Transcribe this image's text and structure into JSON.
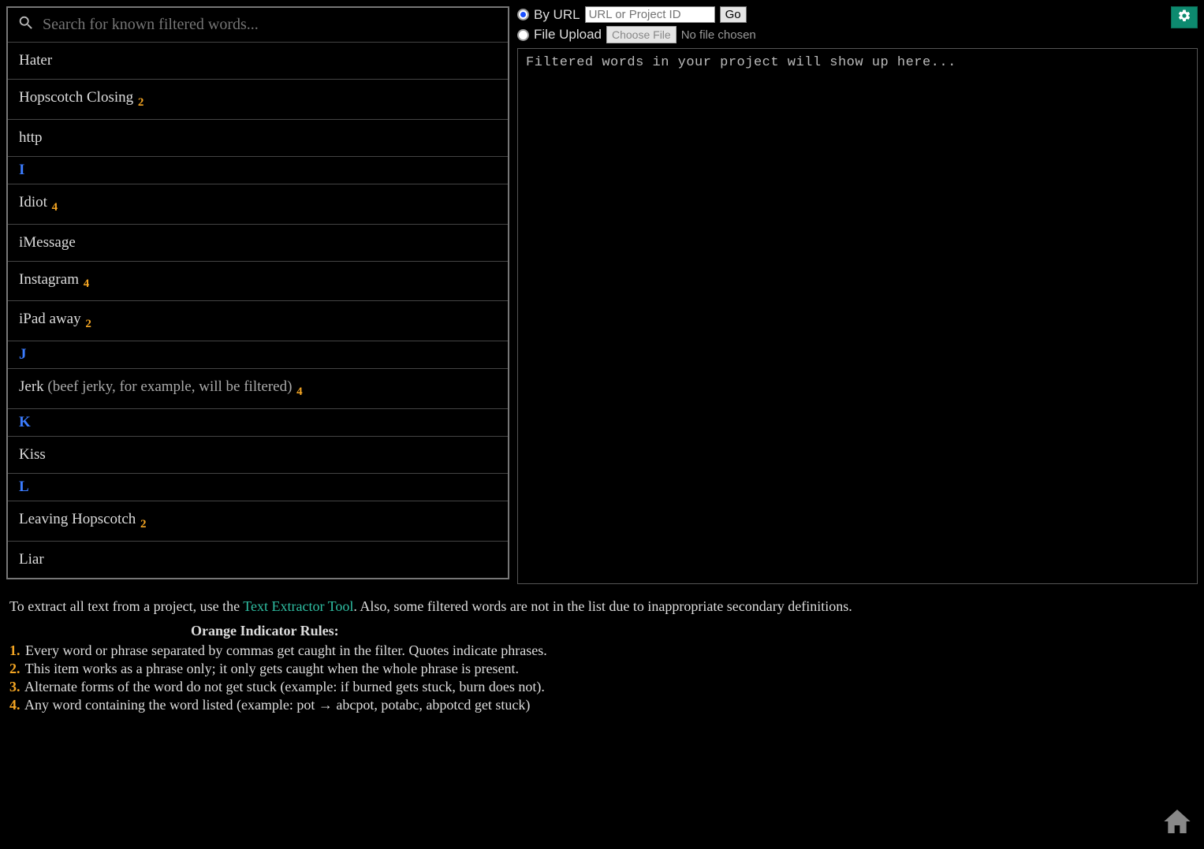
{
  "search": {
    "placeholder": "Search for known filtered words..."
  },
  "wordList": [
    {
      "type": "word",
      "word": "Hater",
      "note": "",
      "indicator": ""
    },
    {
      "type": "word",
      "word": "Hopscotch Closing",
      "note": "",
      "indicator": "2"
    },
    {
      "type": "word",
      "word": "http",
      "note": "",
      "indicator": ""
    },
    {
      "type": "header",
      "letter": "I"
    },
    {
      "type": "word",
      "word": "Idiot",
      "note": "",
      "indicator": "4"
    },
    {
      "type": "word",
      "word": "iMessage",
      "note": "",
      "indicator": ""
    },
    {
      "type": "word",
      "word": "Instagram",
      "note": "",
      "indicator": "4"
    },
    {
      "type": "word",
      "word": "iPad away",
      "note": "",
      "indicator": "2"
    },
    {
      "type": "header",
      "letter": "J"
    },
    {
      "type": "word",
      "word": "Jerk",
      "note": " (beef jerky, for example, will be filtered)",
      "indicator": "4"
    },
    {
      "type": "header",
      "letter": "K"
    },
    {
      "type": "word",
      "word": "Kiss",
      "note": "",
      "indicator": ""
    },
    {
      "type": "header",
      "letter": "L"
    },
    {
      "type": "word",
      "word": "Leaving Hopscotch",
      "note": "",
      "indicator": "2"
    },
    {
      "type": "word",
      "word": "Liar",
      "note": "",
      "indicator": ""
    }
  ],
  "controls": {
    "by_url_label": "By URL",
    "url_placeholder": "URL or Project ID",
    "go_label": "Go",
    "file_upload_label": "File Upload",
    "choose_file_label": "Choose File",
    "no_file_label": "No file chosen"
  },
  "results": {
    "placeholder": "Filtered words in your project will show up here..."
  },
  "footer": {
    "extract_pre": "To extract all text from a project, use the ",
    "tool_link": "Text Extractor Tool",
    "extract_post": ". Also, some filtered words are not in the list due to inappropriate secondary definitions.",
    "rules_title": "Orange Indicator Rules:",
    "rules": [
      {
        "num": "1.",
        "text": "Every word or phrase separated by commas get caught in the filter. Quotes indicate phrases."
      },
      {
        "num": "2.",
        "text": "This item works as a phrase only; it only gets caught when the whole phrase is present."
      },
      {
        "num": "3.",
        "text": "Alternate forms of the word do not get stuck (example: if burned gets stuck, burn does not)."
      },
      {
        "num": "4.",
        "text": "Any word containing the word listed (example: pot → abcpot, potabc, abpotcd get stuck)"
      }
    ]
  }
}
